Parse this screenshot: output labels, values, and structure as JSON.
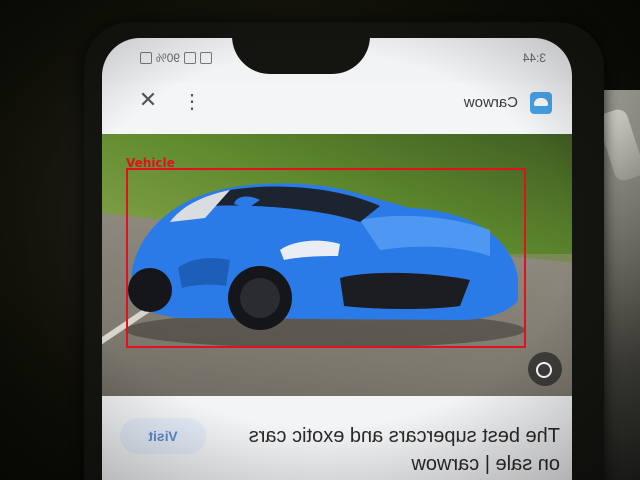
{
  "status_bar": {
    "time": "3:44",
    "battery": "90%"
  },
  "header": {
    "site_name": "Carwow"
  },
  "caption": {
    "title": "The best supercars and exotic cars on sale | carwow",
    "visit_label": "Visit"
  },
  "detection": {
    "label": "Vehicle",
    "color": "#e3111d"
  },
  "colors": {
    "car_body": "#2a7be8",
    "visit_text": "#5d8ad0"
  },
  "icons": {
    "close": "close-icon",
    "more": "more-vert-icon",
    "lens": "google-lens-icon",
    "logo": "carwow-logo-icon"
  }
}
